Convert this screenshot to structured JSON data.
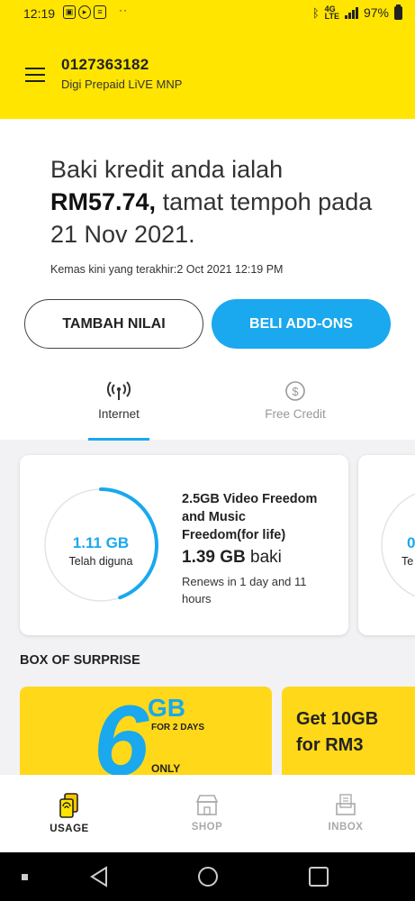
{
  "status_bar": {
    "time": "12:19",
    "dots": "··",
    "battery": "97%",
    "icons": [
      "shopping-bag-icon",
      "play-icon",
      "chat-icon",
      "bluetooth-icon",
      "lte-icon",
      "signal-icon",
      "battery-icon"
    ]
  },
  "header": {
    "phone_number": "0127363182",
    "plan_name": "Digi Prepaid LiVE MNP"
  },
  "credit": {
    "line_prefix": "Baki kredit anda ialah",
    "amount": "RM57.74,",
    "line_suffix": "tamat tempoh pada 21 Nov 2021.",
    "last_updated": "Kemas kini yang terakhir:2 Oct 2021 12:19 PM"
  },
  "actions": {
    "topup_label": "TAMBAH NILAI",
    "addons_label": "BELI ADD-ONS"
  },
  "tabs": [
    {
      "label": "Internet",
      "active": true
    },
    {
      "label": "Free Credit",
      "active": false
    }
  ],
  "usage_cards": [
    {
      "used_value": "1.11 GB",
      "used_label": "Telah diguna",
      "plan": "2.5GB Video Freedom and Music Freedom(for life)",
      "balance_value": "1.39 GB",
      "balance_unit": "baki",
      "renews": "Renews in 1 day and 11 hours",
      "used_fraction": 0.444
    },
    {
      "used_value": "0",
      "used_label": "Te"
    }
  ],
  "box_of_surprise": {
    "title": "BOX OF SURPRISE",
    "promos": [
      {
        "big_number": "6",
        "unit": "GB",
        "period": "FOR 2 DAYS",
        "tag": "ONLY"
      },
      {
        "text": "Get 10GB for RM3"
      }
    ]
  },
  "bottom_nav": [
    {
      "label": "USAGE",
      "icon": "usage-icon",
      "active": true
    },
    {
      "label": "SHOP",
      "icon": "shop-icon",
      "active": false
    },
    {
      "label": "INBOX",
      "icon": "inbox-icon",
      "active": false
    }
  ],
  "colors": {
    "brand_yellow": "#ffe500",
    "accent_blue": "#1aa8ee"
  }
}
